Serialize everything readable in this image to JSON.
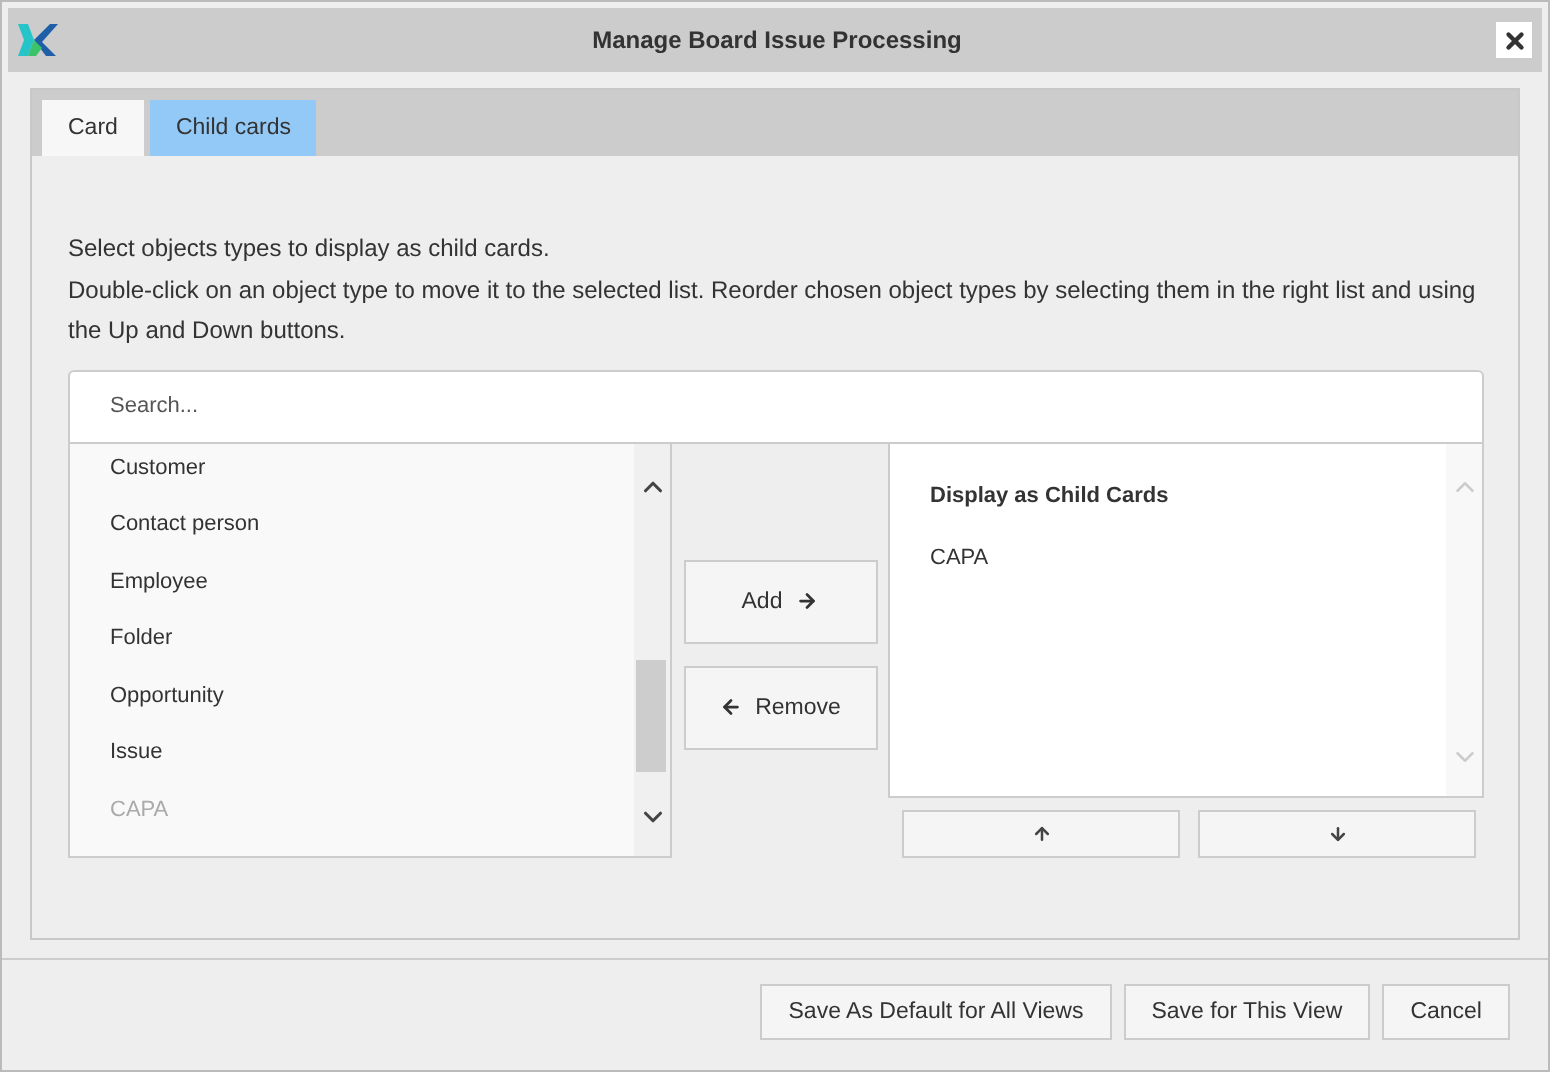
{
  "window": {
    "title": "Manage Board Issue Processing"
  },
  "tabs": [
    {
      "label": "Card",
      "selected": false
    },
    {
      "label": "Child cards",
      "selected": true
    }
  ],
  "instructions": [
    "Select objects types to display as child cards.",
    "Double-click on an object type to move it to the selected list. Reorder chosen object types by selecting them in the right list and using the Up and Down buttons."
  ],
  "search": {
    "placeholder": "Search..."
  },
  "available": [
    {
      "label": "Customer",
      "disabled": false
    },
    {
      "label": "Contact person",
      "disabled": false
    },
    {
      "label": "Employee",
      "disabled": false
    },
    {
      "label": "Folder",
      "disabled": false
    },
    {
      "label": "Opportunity",
      "disabled": false
    },
    {
      "label": "Issue",
      "disabled": false
    },
    {
      "label": "CAPA",
      "disabled": true
    }
  ],
  "move_buttons": [
    {
      "label": "Add",
      "kind": "add"
    },
    {
      "label": "Remove",
      "kind": "remove"
    }
  ],
  "selected_list": {
    "heading": "Display as Child Cards",
    "items": [
      "CAPA"
    ]
  },
  "order_buttons": [
    {
      "kind": "up"
    },
    {
      "kind": "down"
    }
  ],
  "footer_buttons": [
    "Save As Default for All Views",
    "Save for This View",
    "Cancel"
  ]
}
